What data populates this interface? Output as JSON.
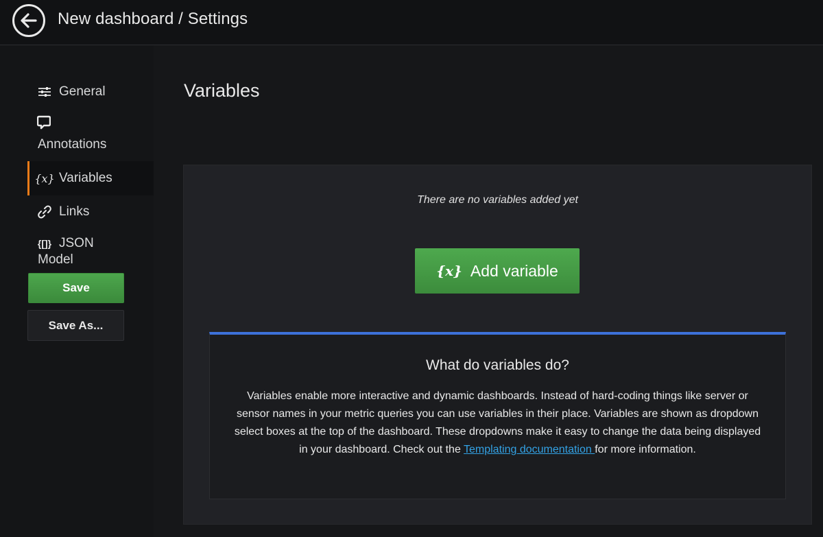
{
  "header": {
    "title": "New dashboard / Settings"
  },
  "sidebar": {
    "items": [
      {
        "label": "General",
        "icon": "sliders-icon"
      },
      {
        "label": "Annotations",
        "icon": "comment-icon"
      },
      {
        "label": "Variables",
        "icon": "variable-icon",
        "active": true
      },
      {
        "label": "Links",
        "icon": "link-icon"
      },
      {
        "label": "JSON",
        "label2": "Model",
        "icon": "json-icon"
      }
    ],
    "save_label": "Save",
    "save_as_label": "Save As..."
  },
  "main": {
    "title": "Variables",
    "empty_text": "There are no variables added yet",
    "add_button": {
      "icon_text": "{x}",
      "label": "Add variable"
    },
    "info": {
      "title": "What do variables do?",
      "body_before": "Variables enable more interactive and dynamic dashboards. Instead of hard-coding things like server or sensor names in your metric queries you can use variables in their place. Variables are shown as dropdown select boxes at the top of the dashboard. These dropdowns make it easy to change the data being displayed in your dashboard. Check out the ",
      "link_text": "Templating documentation ",
      "body_after": "for more information."
    }
  },
  "colors": {
    "accent_active": "#eb7b18",
    "primary_green": "#3f8f3f",
    "info_border": "#3d71d9",
    "link": "#33a2e5"
  }
}
